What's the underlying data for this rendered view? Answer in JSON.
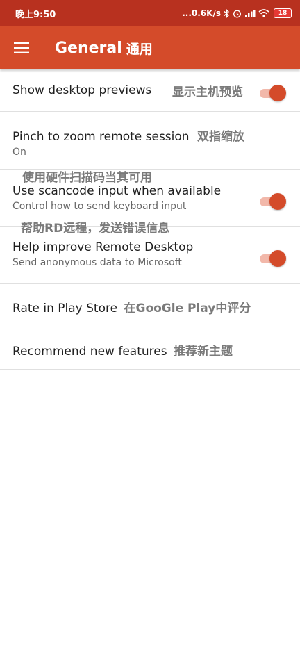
{
  "status_bar": {
    "time": "晚上9:50",
    "network_speed": "...0.6K/s",
    "battery": "18",
    "icons": [
      "bluetooth-icon",
      "alarm-icon",
      "signal-icon",
      "wifi-icon",
      "battery-icon"
    ]
  },
  "app_bar": {
    "title": "General",
    "title_annotation": "通用",
    "menu_icon": "hamburger-menu-icon"
  },
  "settings": [
    {
      "title": "Show desktop previews",
      "annotation": "显示主机预览",
      "toggle": true
    },
    {
      "title": "Pinch to zoom remote session",
      "annotation": "双指缩放",
      "subtitle": "On"
    },
    {
      "title": "Use scancode input when available",
      "annotation": "使用硬件扫描码当其可用",
      "subtitle": "Control how to send keyboard input",
      "toggle": true
    },
    {
      "title": "Help improve Remote Desktop",
      "annotation": "帮助RD远程，发送错误信息",
      "subtitle": "Send anonymous data to Microsoft",
      "toggle": true
    },
    {
      "title": "Rate in Play Store",
      "annotation": "在GooGle Play中评分"
    },
    {
      "title": "Recommend new features",
      "annotation": "推荐新主题"
    }
  ],
  "colors": {
    "status_bar": "#b8311f",
    "app_bar": "#d44b2a",
    "toggle_thumb": "#d44b2a",
    "toggle_track": "#f2b8aa",
    "divider": "#e0e0e0"
  }
}
